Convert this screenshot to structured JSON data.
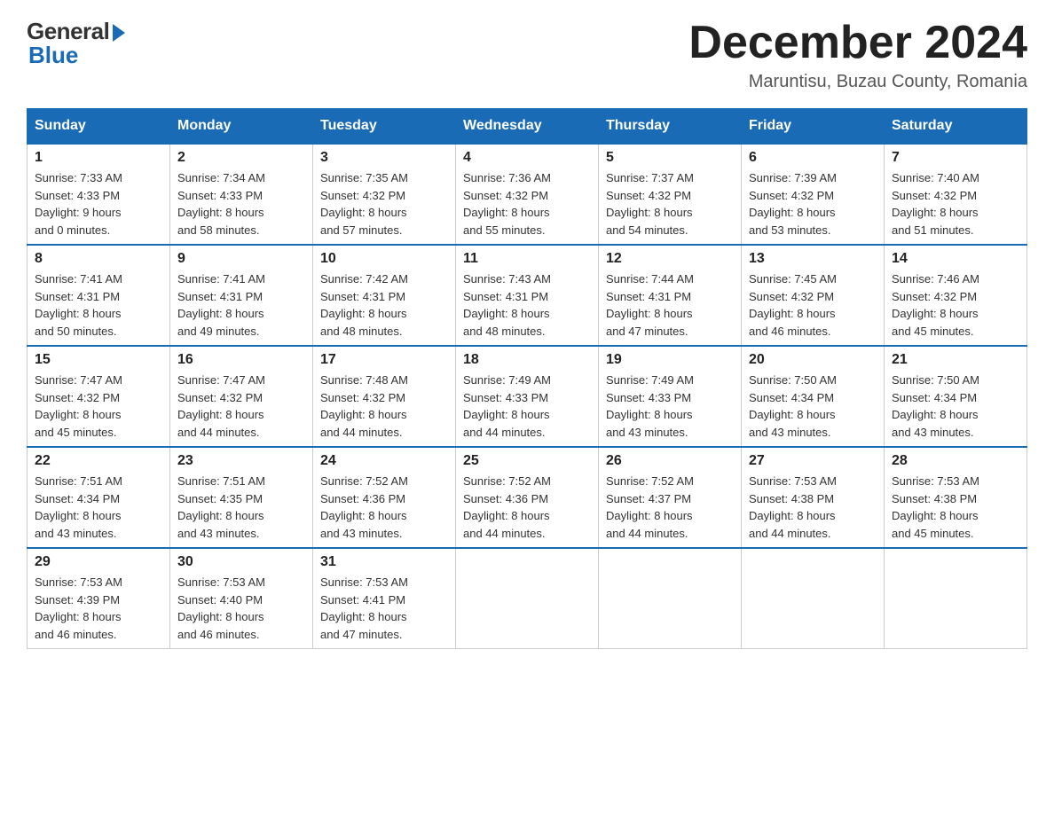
{
  "logo": {
    "general": "General",
    "blue": "Blue"
  },
  "header": {
    "month_title": "December 2024",
    "location": "Maruntisu, Buzau County, Romania"
  },
  "weekdays": [
    "Sunday",
    "Monday",
    "Tuesday",
    "Wednesday",
    "Thursday",
    "Friday",
    "Saturday"
  ],
  "weeks": [
    [
      {
        "day": "1",
        "sunrise": "7:33 AM",
        "sunset": "4:33 PM",
        "daylight": "9 hours and 0 minutes."
      },
      {
        "day": "2",
        "sunrise": "7:34 AM",
        "sunset": "4:33 PM",
        "daylight": "8 hours and 58 minutes."
      },
      {
        "day": "3",
        "sunrise": "7:35 AM",
        "sunset": "4:32 PM",
        "daylight": "8 hours and 57 minutes."
      },
      {
        "day": "4",
        "sunrise": "7:36 AM",
        "sunset": "4:32 PM",
        "daylight": "8 hours and 55 minutes."
      },
      {
        "day": "5",
        "sunrise": "7:37 AM",
        "sunset": "4:32 PM",
        "daylight": "8 hours and 54 minutes."
      },
      {
        "day": "6",
        "sunrise": "7:39 AM",
        "sunset": "4:32 PM",
        "daylight": "8 hours and 53 minutes."
      },
      {
        "day": "7",
        "sunrise": "7:40 AM",
        "sunset": "4:32 PM",
        "daylight": "8 hours and 51 minutes."
      }
    ],
    [
      {
        "day": "8",
        "sunrise": "7:41 AM",
        "sunset": "4:31 PM",
        "daylight": "8 hours and 50 minutes."
      },
      {
        "day": "9",
        "sunrise": "7:41 AM",
        "sunset": "4:31 PM",
        "daylight": "8 hours and 49 minutes."
      },
      {
        "day": "10",
        "sunrise": "7:42 AM",
        "sunset": "4:31 PM",
        "daylight": "8 hours and 48 minutes."
      },
      {
        "day": "11",
        "sunrise": "7:43 AM",
        "sunset": "4:31 PM",
        "daylight": "8 hours and 48 minutes."
      },
      {
        "day": "12",
        "sunrise": "7:44 AM",
        "sunset": "4:31 PM",
        "daylight": "8 hours and 47 minutes."
      },
      {
        "day": "13",
        "sunrise": "7:45 AM",
        "sunset": "4:32 PM",
        "daylight": "8 hours and 46 minutes."
      },
      {
        "day": "14",
        "sunrise": "7:46 AM",
        "sunset": "4:32 PM",
        "daylight": "8 hours and 45 minutes."
      }
    ],
    [
      {
        "day": "15",
        "sunrise": "7:47 AM",
        "sunset": "4:32 PM",
        "daylight": "8 hours and 45 minutes."
      },
      {
        "day": "16",
        "sunrise": "7:47 AM",
        "sunset": "4:32 PM",
        "daylight": "8 hours and 44 minutes."
      },
      {
        "day": "17",
        "sunrise": "7:48 AM",
        "sunset": "4:32 PM",
        "daylight": "8 hours and 44 minutes."
      },
      {
        "day": "18",
        "sunrise": "7:49 AM",
        "sunset": "4:33 PM",
        "daylight": "8 hours and 44 minutes."
      },
      {
        "day": "19",
        "sunrise": "7:49 AM",
        "sunset": "4:33 PM",
        "daylight": "8 hours and 43 minutes."
      },
      {
        "day": "20",
        "sunrise": "7:50 AM",
        "sunset": "4:34 PM",
        "daylight": "8 hours and 43 minutes."
      },
      {
        "day": "21",
        "sunrise": "7:50 AM",
        "sunset": "4:34 PM",
        "daylight": "8 hours and 43 minutes."
      }
    ],
    [
      {
        "day": "22",
        "sunrise": "7:51 AM",
        "sunset": "4:34 PM",
        "daylight": "8 hours and 43 minutes."
      },
      {
        "day": "23",
        "sunrise": "7:51 AM",
        "sunset": "4:35 PM",
        "daylight": "8 hours and 43 minutes."
      },
      {
        "day": "24",
        "sunrise": "7:52 AM",
        "sunset": "4:36 PM",
        "daylight": "8 hours and 43 minutes."
      },
      {
        "day": "25",
        "sunrise": "7:52 AM",
        "sunset": "4:36 PM",
        "daylight": "8 hours and 44 minutes."
      },
      {
        "day": "26",
        "sunrise": "7:52 AM",
        "sunset": "4:37 PM",
        "daylight": "8 hours and 44 minutes."
      },
      {
        "day": "27",
        "sunrise": "7:53 AM",
        "sunset": "4:38 PM",
        "daylight": "8 hours and 44 minutes."
      },
      {
        "day": "28",
        "sunrise": "7:53 AM",
        "sunset": "4:38 PM",
        "daylight": "8 hours and 45 minutes."
      }
    ],
    [
      {
        "day": "29",
        "sunrise": "7:53 AM",
        "sunset": "4:39 PM",
        "daylight": "8 hours and 46 minutes."
      },
      {
        "day": "30",
        "sunrise": "7:53 AM",
        "sunset": "4:40 PM",
        "daylight": "8 hours and 46 minutes."
      },
      {
        "day": "31",
        "sunrise": "7:53 AM",
        "sunset": "4:41 PM",
        "daylight": "8 hours and 47 minutes."
      },
      null,
      null,
      null,
      null
    ]
  ],
  "labels": {
    "sunrise": "Sunrise:",
    "sunset": "Sunset:",
    "daylight": "Daylight:"
  }
}
